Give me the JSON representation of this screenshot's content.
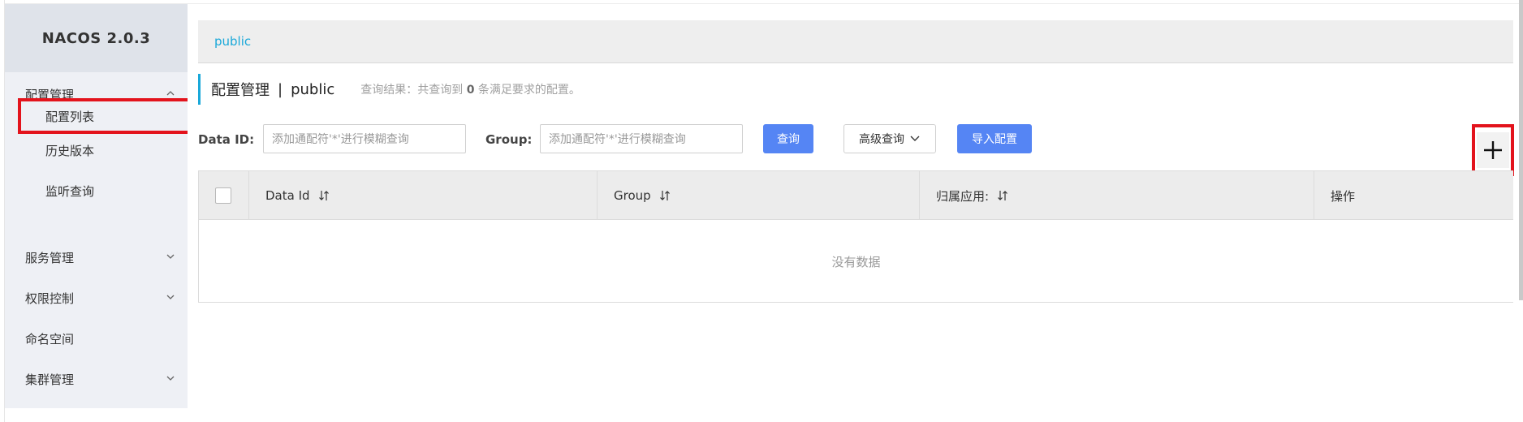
{
  "sidebar": {
    "brand": "NACOS 2.0.3",
    "items": [
      {
        "label": "配置管理"
      },
      {
        "label": "配置列表"
      },
      {
        "label": "历史版本"
      },
      {
        "label": "监听查询"
      },
      {
        "label": "服务管理"
      },
      {
        "label": "权限控制"
      },
      {
        "label": "命名空间"
      },
      {
        "label": "集群管理"
      }
    ]
  },
  "breadcrumb": {
    "namespace": "public"
  },
  "header": {
    "title": "配置管理",
    "separator": "|",
    "namespace": "public",
    "result_prefix": "查询结果：共查询到",
    "result_count": "0",
    "result_suffix": "条满足要求的配置。"
  },
  "filters": {
    "data_id_label": "Data ID:",
    "data_id_placeholder": "添加通配符'*'进行模糊查询",
    "group_label": "Group:",
    "group_placeholder": "添加通配符'*'进行模糊查询",
    "search_label": "查询",
    "advanced_label": "高级查询",
    "import_label": "导入配置"
  },
  "table": {
    "columns": [
      "Data Id",
      "Group",
      "归属应用:",
      "操作"
    ],
    "empty_text": "没有数据"
  },
  "colors": {
    "accent": "#19a8d9",
    "primary_button": "#5585f4",
    "highlight": "#e3131c"
  }
}
